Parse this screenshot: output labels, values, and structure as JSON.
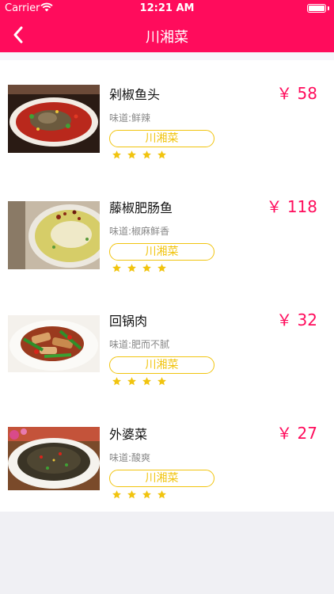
{
  "status_bar": {
    "carrier": "Carrier",
    "time": "12:21 AM"
  },
  "nav": {
    "title": "川湘菜",
    "back_icon": "chevron-left-icon"
  },
  "colors": {
    "accent": "#ff0c5c",
    "tag": "#f1c40f",
    "star": "#f1c40f"
  },
  "dishes": [
    {
      "name": "剁椒鱼头",
      "taste": "味道:鲜辣",
      "category": "川湘菜",
      "price": "￥ 58",
      "stars": 4,
      "image": "fish-head-dish-photo"
    },
    {
      "name": "藤椒肥肠鱼",
      "taste": "味道:椒麻鲜香",
      "category": "川湘菜",
      "price": "￥ 118",
      "stars": 4,
      "image": "fish-soup-dish-photo"
    },
    {
      "name": "回锅肉",
      "taste": "味道:肥而不腻",
      "category": "川湘菜",
      "price": "￥ 32",
      "stars": 4,
      "image": "twice-cooked-pork-photo"
    },
    {
      "name": "外婆菜",
      "taste": "味道:酸爽",
      "category": "川湘菜",
      "price": "￥ 27",
      "stars": 4,
      "image": "grandma-vegetables-photo"
    }
  ]
}
